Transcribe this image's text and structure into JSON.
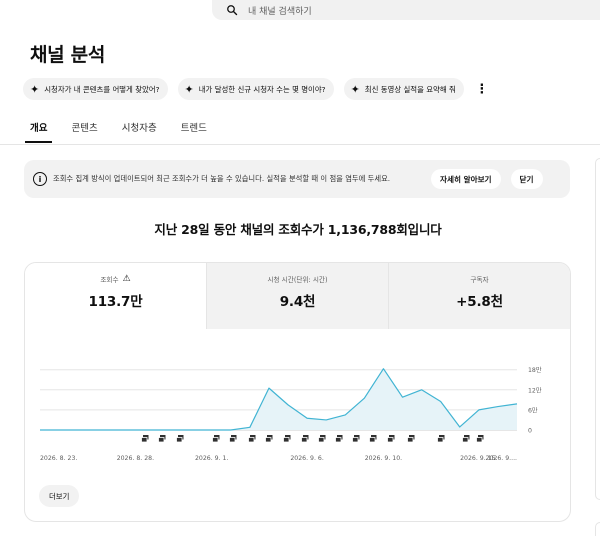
{
  "search": {
    "placeholder": "내 채널 검색하기"
  },
  "page": {
    "title": "채널 분석"
  },
  "chips": [
    {
      "label": "시청자가 내 콘텐츠를 어떻게 찾았어?"
    },
    {
      "label": "내가 달성한 신규 시청자 수는 몇 명이야?"
    },
    {
      "label": "최신 동영상 실적을 요약해 줘"
    }
  ],
  "tabs": [
    {
      "label": "개요",
      "active": true
    },
    {
      "label": "콘텐츠",
      "active": false
    },
    {
      "label": "시청자층",
      "active": false
    },
    {
      "label": "트렌드",
      "active": false
    }
  ],
  "banner": {
    "text": "조회수 집계 방식이 업데이트되어 최근 조회수가 더 높을 수 있습니다. 실적을 분석할 때 이 점을 염두에 두세요.",
    "learn_more": "자세히 알아보기",
    "close": "닫기"
  },
  "summary": {
    "text": "지난 28일 동안 채널의 조회수가 1,136,788회입니다"
  },
  "metrics": [
    {
      "label": "조회수",
      "value": "113.7만",
      "warning": true,
      "active": true
    },
    {
      "label": "시청 시간(단위: 시간)",
      "value": "9.4천",
      "active": false
    },
    {
      "label": "구독자",
      "value": "+5.8천",
      "active": false
    }
  ],
  "more_button": {
    "label": "더보기"
  },
  "colors": {
    "line": "#41b4d3",
    "fill": "#e6f3f8",
    "grid": "#e5e5e5",
    "text_muted": "#606060"
  },
  "chart_data": {
    "type": "area",
    "series": [
      {
        "values": [
          0,
          0,
          0,
          0,
          0,
          0,
          0,
          0,
          0,
          0,
          0,
          0.8,
          12.5,
          7.5,
          3.5,
          3,
          4.5,
          9.5,
          18.3,
          9.8,
          12,
          8.5,
          0.9,
          6,
          7,
          7.8
        ]
      }
    ],
    "x_tick_labels": [
      "2026. 8. 23.",
      "2026. 8. 28.",
      "2026. 9. 1.",
      "2026. 9. 6.",
      "2026. 9. 10.",
      "2026. 9. 15.",
      "2026. 9...."
    ],
    "y_tick_labels": [
      "18만",
      "12만",
      "6만",
      "0"
    ],
    "y_ticks": [
      18,
      12,
      6,
      0
    ],
    "ylim": [
      0,
      20
    ],
    "ylabel_unit": "만",
    "grid": true,
    "video_marker_count": 18
  }
}
